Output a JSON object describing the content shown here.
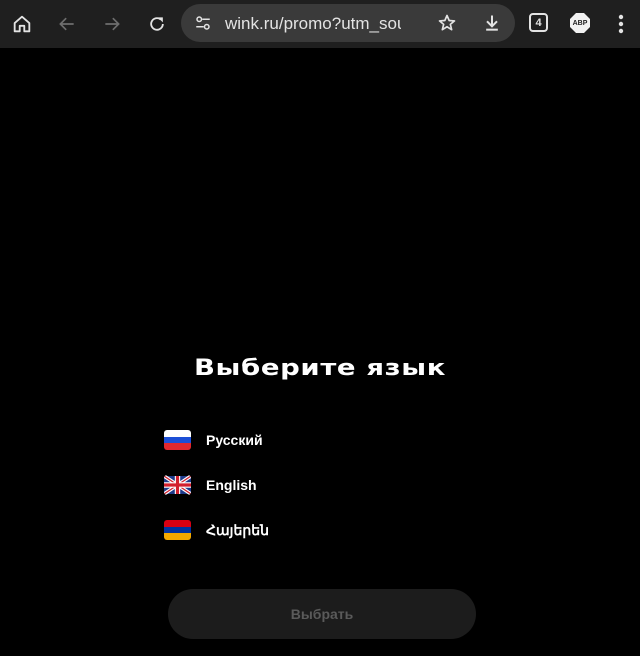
{
  "browser": {
    "url": "wink.ru/promo?utm_sourc",
    "tab_count": "4",
    "extension_label": "ABP"
  },
  "page": {
    "title": "Выберите язык",
    "languages": [
      {
        "label": "Русский",
        "flag": "russia-flag",
        "colors": [
          "#ffffff",
          "#1c4fd6",
          "#e0282e"
        ]
      },
      {
        "label": "English",
        "flag": "uk-flag",
        "colors": [
          "#1e3a8a",
          "#ffffff",
          "#d21f2d"
        ]
      },
      {
        "label": "Հայերեն",
        "flag": "armenia-flag",
        "colors": [
          "#d90012",
          "#0033a0",
          "#f2a800"
        ]
      }
    ],
    "submit_label": "Выбрать"
  },
  "colors": {
    "background": "#000000",
    "toolbar": "#1f1f1f",
    "omnibox": "#3a3a3a",
    "button_disabled": "#1c1c1c",
    "button_text_disabled": "#5a5a5a"
  }
}
